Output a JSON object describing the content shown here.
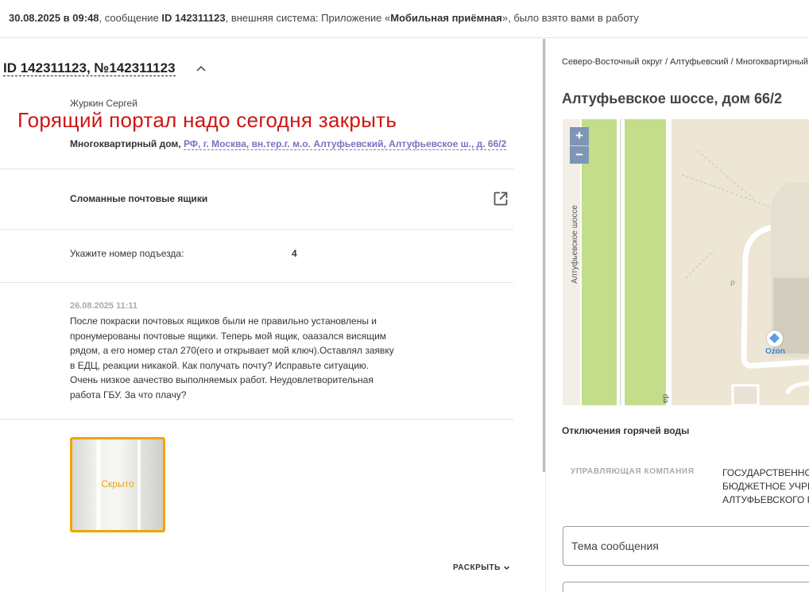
{
  "notice": {
    "datetime": "30.08.2025 в 09:48",
    "part1": ", сообщение ",
    "id_label": "ID 142311123",
    "part2": ", внешняя система: Приложение «",
    "system_name": "Мобильная приёмная",
    "part3": "», было взято вами в работу"
  },
  "ticket": {
    "title": "ID 142311123, №142311123",
    "author": "Журкин Сергей",
    "banner": "Горящий портал надо сегодня закрыть",
    "object_type": "Многоквартирный дом,",
    "address": "РФ, г. Москва, вн.тер.г. м.о. Алтуфьевский, Алтуфьевское ш., д. 66/2",
    "category": "Сломанные почтовые ящики",
    "entrance_label": "Укажите номер подъезда:",
    "entrance_value": "4",
    "message": {
      "date": "26.08.2025 11:11",
      "text": "После покраски почтовых ящиков были не правильно установлены и пронумерованы почтовые ящики. Теперь мой ящик, оаазался висящим рядом, а его номер стал 270(его и открывает мой ключ).Оставлял заявку в ЕДЦ, реакции никакой. Как получать почту? Исправьте ситуацию. Очень низкое аачество выполняемых работ. Неудовлетворительная работа ГБУ. За что плачу?"
    },
    "attachment_label": "Скрыто",
    "expand_label": "РАСКРЫТЬ"
  },
  "side": {
    "breadcrumbs": "Северо-Восточный округ / Алтуфьевский / Многоквартирный дом",
    "address_title": "Алтуфьевское шоссе, дом 66/2",
    "map": {
      "zoom_in": "+",
      "zoom_out": "−",
      "road_label": "Алтуфьевское шоссе",
      "poi_label": "Ozon",
      "parking_label": "P",
      "cut_label": "ер",
      "colors": {
        "road": "#c3dd8a",
        "background": "#f1ece1",
        "marker": "#5a9ee0"
      }
    },
    "outage_title": "Отключения горячей воды",
    "uk_label": "УПРАВЛЯЮЩАЯ КОМПАНИЯ",
    "uk_value": "ГОСУДАРСТВЕННОЕ БЮДЖЕТНОЕ УЧРЕЖДЕНИЕ АЛТУФЬЕВСКОГО Р",
    "subject_placeholder": "Тема сообщения"
  }
}
